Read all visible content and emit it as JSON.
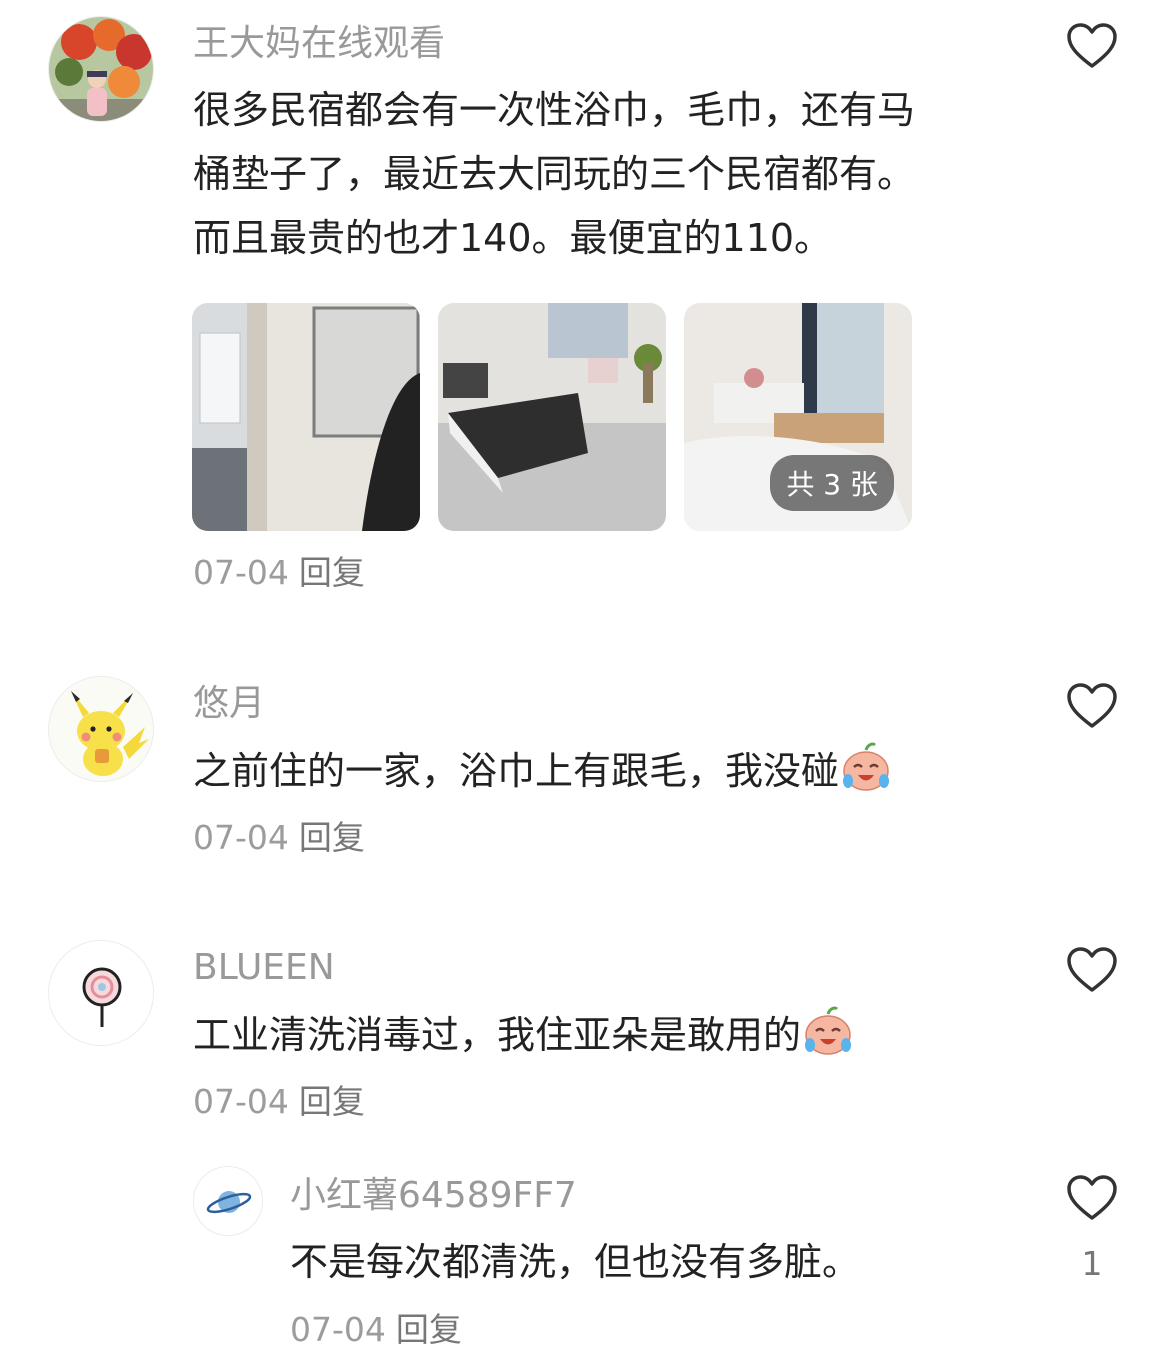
{
  "comments": [
    {
      "username": "王大妈在线观看",
      "text_lines": [
        "很多民宿都会有一次性浴巾，毛巾，还有马",
        "桶垫子了，最近去大同玩的三个民宿都有。",
        "而且最贵的也才140。最便宜的110。"
      ],
      "images_badge": "共 3 张",
      "date": "07-04",
      "reply_label": "回复",
      "avatar_icon": "flower-photo-avatar-icon"
    },
    {
      "username": "悠月",
      "text": "之前住的一家，浴巾上有跟毛，我没碰",
      "date": "07-04",
      "reply_label": "回复",
      "avatar_icon": "pikachu-avatar-icon"
    },
    {
      "username": "BLUEEN",
      "text": "工业清洗消毒过，我住亚朵是敢用的",
      "date": "07-04",
      "reply_label": "回复",
      "avatar_icon": "lollipop-avatar-icon"
    }
  ],
  "replies": [
    {
      "username": "小红薯64589FF7",
      "text": "不是每次都清洗，但也没有多脏。",
      "date": "07-04",
      "reply_label": "回复",
      "like_count": "1",
      "avatar_icon": "planet-avatar-icon"
    }
  ],
  "colors": {
    "username": "#999999",
    "text": "#222222",
    "meta": "#9c9c9c",
    "icon": "#333333"
  }
}
